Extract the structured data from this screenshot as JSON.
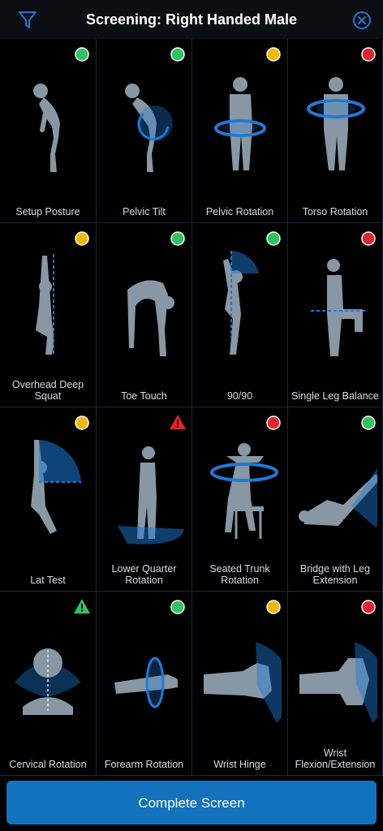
{
  "header": {
    "title": "Screening: Right Handed Male",
    "filter_icon": "filter-icon",
    "close_icon": "close-circle-icon"
  },
  "colors": {
    "green": "#2ec260",
    "yellow": "#f5b800",
    "red": "#e2222f",
    "figure": "#8897a4",
    "accent": "#1e7ad8",
    "button": "#1272bd"
  },
  "tests": [
    {
      "label": "Setup Posture",
      "status": "green"
    },
    {
      "label": "Pelvic Tilt",
      "status": "green"
    },
    {
      "label": "Pelvic Rotation",
      "status": "yellow"
    },
    {
      "label": "Torso Rotation",
      "status": "red"
    },
    {
      "label": "Overhead Deep\nSquat",
      "status": "yellow"
    },
    {
      "label": "Toe Touch",
      "status": "green"
    },
    {
      "label": "90/90",
      "status": "green"
    },
    {
      "label": "Single Leg Balance",
      "status": "red"
    },
    {
      "label": "Lat Test",
      "status": "yellow"
    },
    {
      "label": "Lower Quarter\nRotation",
      "status": "red-warning"
    },
    {
      "label": "Seated Trunk\nRotation",
      "status": "red"
    },
    {
      "label": "Bridge with Leg\nExtension",
      "status": "green"
    },
    {
      "label": "Cervical Rotation",
      "status": "green-warning"
    },
    {
      "label": "Forearm Rotation",
      "status": "green"
    },
    {
      "label": "Wrist Hinge",
      "status": "yellow"
    },
    {
      "label": "Wrist\nFlexion/Extension",
      "status": "red"
    }
  ],
  "footer": {
    "complete_label": "Complete Screen"
  }
}
